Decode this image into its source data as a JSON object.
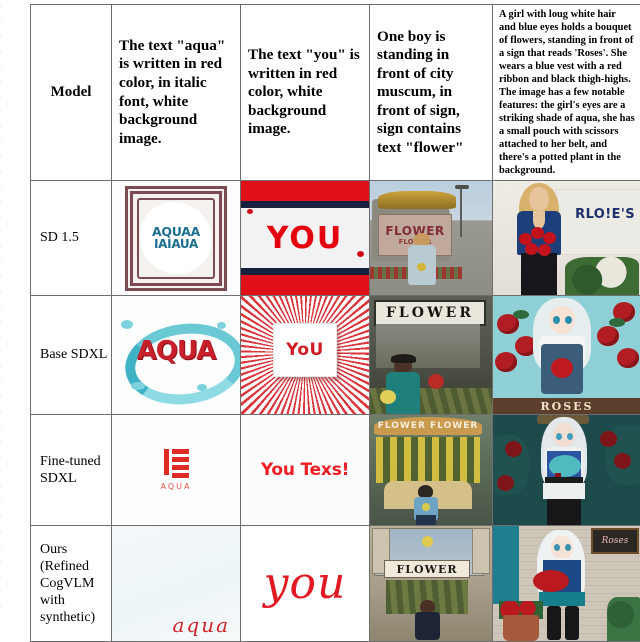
{
  "table": {
    "columns": {
      "model_header": "Model",
      "prompts": [
        "The text \"aqua\" is written in red color, in italic font, white background image.",
        "The text \"you\" is written in red color, white background image.",
        "One boy is standing in front of city muscum, in front of sign, sign contains text \"flower\"",
        "A girl with loug white hair and blue eyes holds a bouquet of flowers, standing in front of a sign that reads 'Roses'. She wears a blue vest with a red ribbon and black thigh-highs. The image has a few notable features: the girl's eyes are a striking shade of aqua, she has a small pouch with scissors attached to her belt, and there's a potted plant in the background."
      ]
    },
    "rows": [
      {
        "label": "SD 1.5",
        "cells": [
          {
            "name": "sd15-aqua",
            "render_text_line1": "AQUAA",
            "render_text_line2": "IAIAUA"
          },
          {
            "name": "sd15-you",
            "render_text": "YOU"
          },
          {
            "name": "sd15-flower-boy",
            "sign_text": "FLOWER",
            "sign_subtext": "FLOWER"
          },
          {
            "name": "sd15-roses-woman",
            "sign_text": "RLO!E'S"
          }
        ]
      },
      {
        "label": "Base SDXL",
        "cells": [
          {
            "name": "basesdxl-aqua",
            "render_text": "AQUA"
          },
          {
            "name": "basesdxl-you",
            "render_text": "YoU"
          },
          {
            "name": "basesdxl-flower-boy",
            "sign_text": "FLOWER"
          },
          {
            "name": "basesdxl-roses-girl",
            "sign_text": "ROSES"
          }
        ]
      },
      {
        "label": "Fine-tuned SDXL",
        "cells": [
          {
            "name": "ftsdxl-aqua",
            "render_text": "AQUA"
          },
          {
            "name": "ftsdxl-you",
            "render_text": "You Texs!"
          },
          {
            "name": "ftsdxl-flower-boy",
            "sign_text": "FLOWER FLOWER"
          },
          {
            "name": "ftsdxl-roses-girl",
            "sign_text": ""
          }
        ]
      },
      {
        "label": "Ours (Refined CogVLM with synthetic)",
        "cells": [
          {
            "name": "ours-aqua",
            "render_text": "aqua"
          },
          {
            "name": "ours-you",
            "render_text": "you"
          },
          {
            "name": "ours-flower-boy",
            "sign_text": "FLOWER"
          },
          {
            "name": "ours-roses-girl",
            "sign_text": "Roses"
          }
        ]
      }
    ]
  },
  "colors": {
    "red_text": "#e01b24",
    "teal_text": "#1c6f8f",
    "navy": "#15203c",
    "grid_line": "#6e6e6e"
  }
}
